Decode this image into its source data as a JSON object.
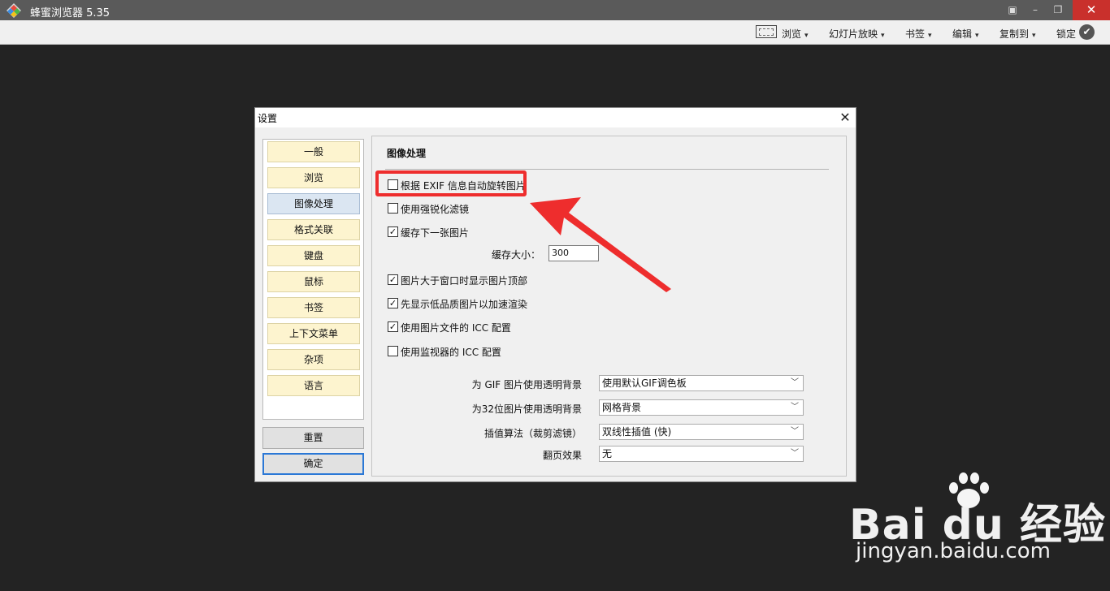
{
  "app": {
    "title": "蜂蜜浏览器 5.35"
  },
  "window_controls": {
    "minimize": "–",
    "restore": "❐",
    "close": "✕",
    "extra": "▣"
  },
  "toolbar": {
    "items": [
      {
        "label": "浏览"
      },
      {
        "label": "幻灯片放映"
      },
      {
        "label": "书签"
      },
      {
        "label": "编辑"
      },
      {
        "label": "复制到"
      },
      {
        "label": "锁定"
      }
    ],
    "caret": "▾",
    "lock_check": "✔"
  },
  "dialog": {
    "title": "设置",
    "close": "✕",
    "nav": [
      "一般",
      "浏览",
      "图像处理",
      "格式关联",
      "键盘",
      "鼠标",
      "书签",
      "上下文菜单",
      "杂项",
      "语言"
    ],
    "active_nav": "图像处理",
    "reset_label": "重置",
    "ok_label": "确定",
    "section_title": "图像处理",
    "checkboxes": [
      {
        "label": "根据 EXIF 信息自动旋转图片",
        "checked": false,
        "mark": ""
      },
      {
        "label": "使用强锐化滤镜",
        "checked": false,
        "mark": ""
      },
      {
        "label": "缓存下一张图片",
        "checked": true,
        "mark": "✓"
      },
      {
        "label": "图片大于窗口时显示图片顶部",
        "checked": true,
        "mark": "✓"
      },
      {
        "label": "先显示低品质图片以加速渲染",
        "checked": true,
        "mark": "✓"
      },
      {
        "label": "使用图片文件的 ICC 配置",
        "checked": true,
        "mark": "✓"
      },
      {
        "label": "使用监视器的 ICC 配置",
        "checked": false,
        "mark": ""
      }
    ],
    "cache_size_label": "缓存大小：",
    "cache_size_value": "300",
    "selects": [
      {
        "label": "为 GIF 图片使用透明背景",
        "value": "使用默认GIF调色板"
      },
      {
        "label": "为32位图片使用透明背景",
        "value": "网格背景"
      },
      {
        "label": "插值算法（裁剪滤镜）",
        "value": "双线性插值 (快)"
      },
      {
        "label": "翻页效果",
        "value": "无"
      }
    ],
    "select_caret": "﹀"
  },
  "watermark": {
    "brand": "Bai du 经验",
    "url": "jingyan.baidu.com"
  },
  "colors": {
    "highlight": "#ee2d2d",
    "titlebar": "#5a5a5a",
    "close_button": "#c9302c",
    "nav_bg": "#fdf4cf",
    "nav_active": "#dbe6f2"
  }
}
